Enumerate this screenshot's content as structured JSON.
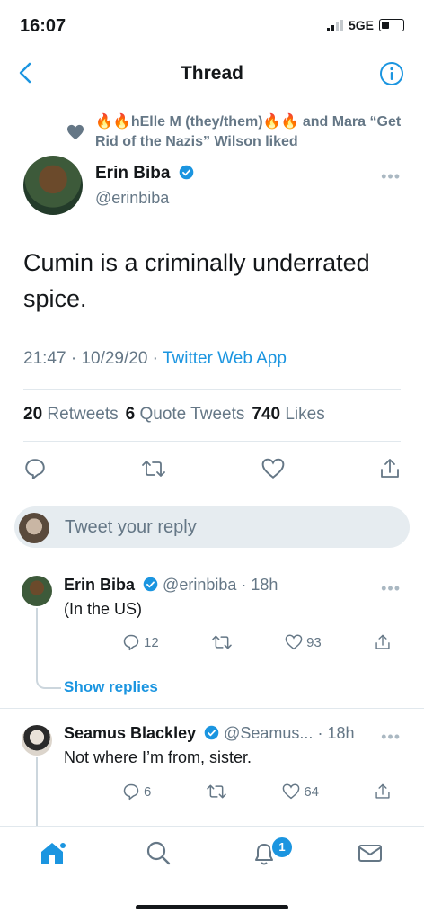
{
  "status_bar": {
    "time": "16:07",
    "network": "5GE"
  },
  "nav": {
    "title": "Thread"
  },
  "liked_by": {
    "text": "🔥🔥hElle M (they/them)🔥🔥 and Mara “Get Rid of the Nazis” Wilson liked"
  },
  "tweet": {
    "author_name": "Erin Biba",
    "author_handle": "@erinbiba",
    "text": "Cumin is a criminally underrated spice.",
    "time": "21:47",
    "date": "10/29/20",
    "source": "Twitter Web App",
    "retweets_count": "20",
    "retweets_label": "Retweets",
    "quotes_count": "6",
    "quotes_label": "Quote Tweets",
    "likes_count": "740",
    "likes_label": "Likes"
  },
  "reply_box": {
    "placeholder": "Tweet your reply"
  },
  "replies": [
    {
      "name": "Erin Biba",
      "handle": "@erinbiba",
      "age": "18h",
      "text": "(In the US)",
      "reply_count": "12",
      "like_count": "93"
    },
    {
      "name": "Seamus Blackley",
      "handle": "@Seamus...",
      "age": "18h",
      "text": "Not where I’m from, sister.",
      "reply_count": "6",
      "like_count": "64"
    }
  ],
  "show_replies": "Show replies",
  "tabbar": {
    "notifications_badge": "1"
  },
  "colors": {
    "accent": "#1b95e0",
    "text": "#14171a",
    "secondary": "#657786"
  }
}
